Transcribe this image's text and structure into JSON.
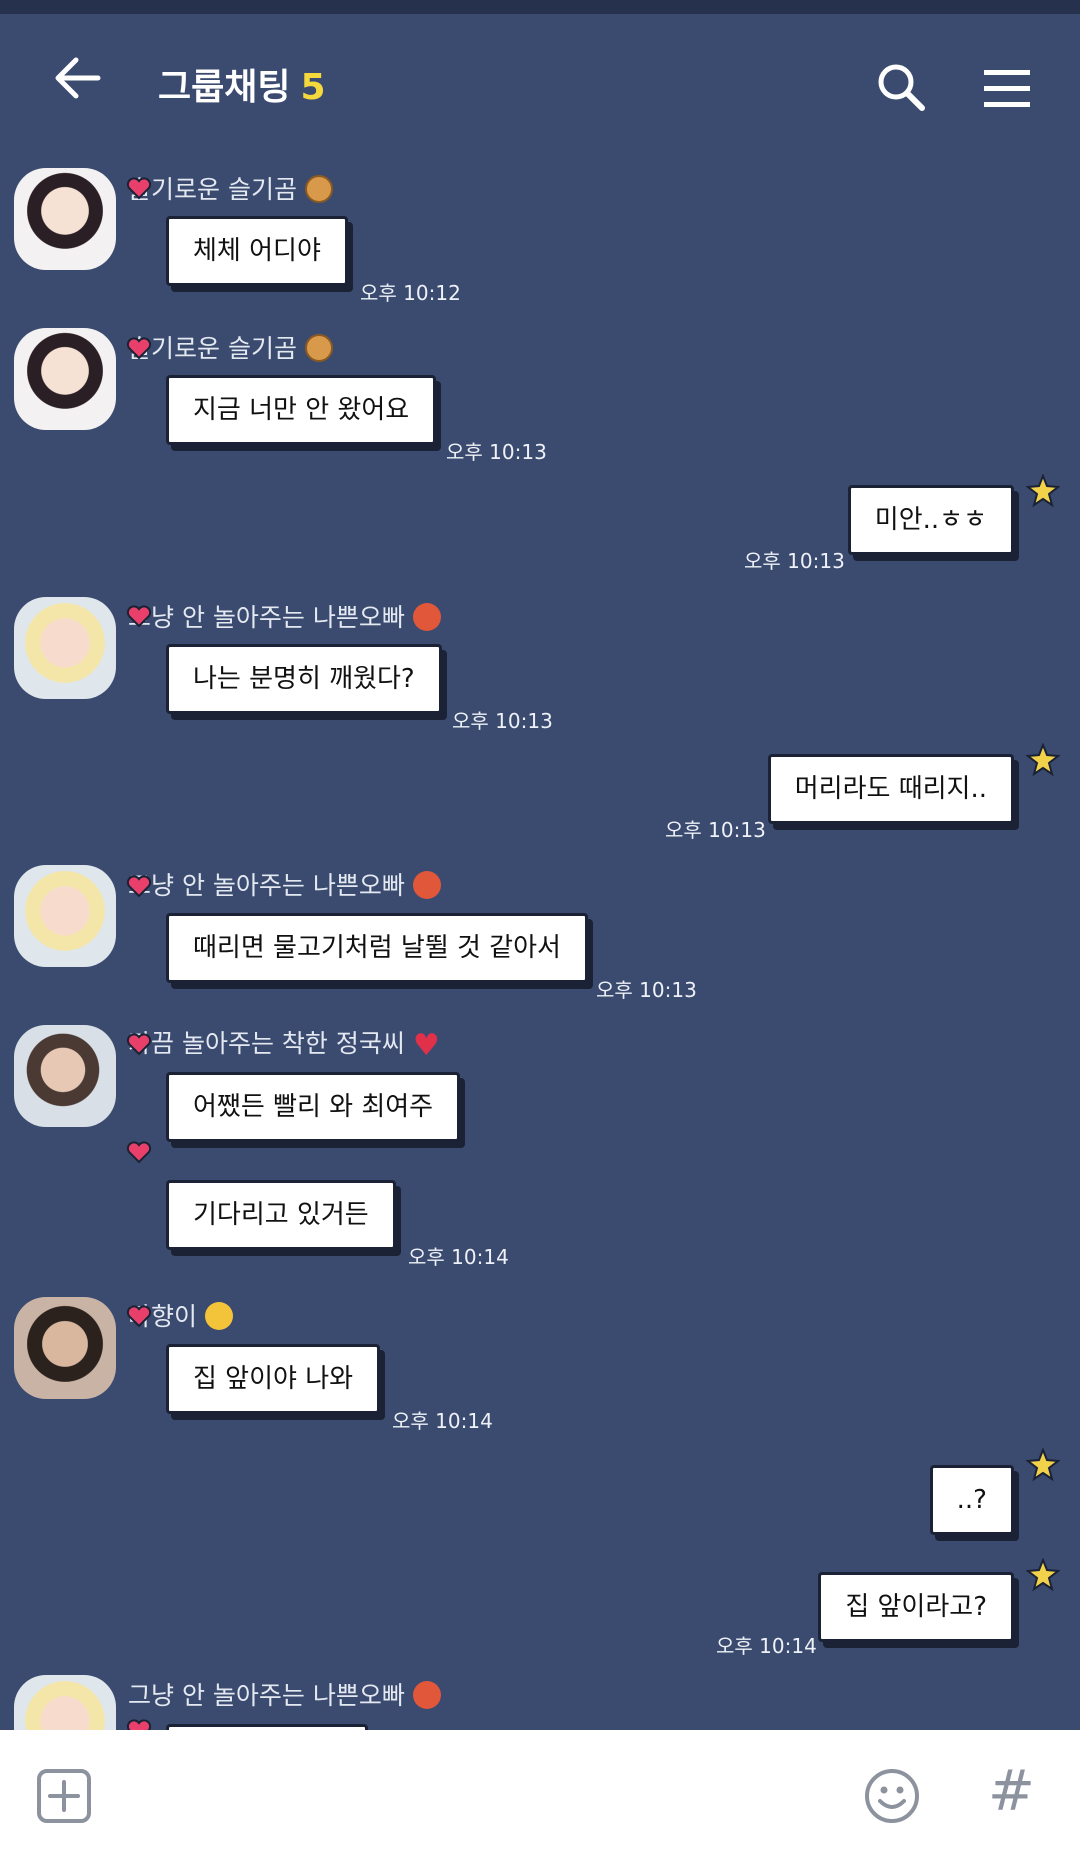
{
  "header": {
    "title": "그룹채팅",
    "member_count": "5"
  },
  "messages": [
    {
      "sender": "슬기로운 슬기곰",
      "text": "체체 어디야",
      "time": "오후 10:12"
    },
    {
      "sender": "슬기로운 슬기곰",
      "text": "지금 너만 안 왔어요",
      "time": "오후 10:13"
    },
    {
      "text": "미안..ㅎㅎ",
      "time": "오후 10:13"
    },
    {
      "sender": "그냥 안 놀아주는 나쁜오빠",
      "text": "나는 분명히 깨웠다?",
      "time": "오후 10:13"
    },
    {
      "text": "머리라도 때리지..",
      "time": "오후 10:13"
    },
    {
      "sender": "그냥 안 놀아주는 나쁜오빠",
      "text": "때리면 물고기처럼 날뛸 것 같아서",
      "time": "오후 10:13"
    },
    {
      "sender": "가끔 놀아주는 착한 정국씨",
      "text": "어쨌든 빨리 와 최여주"
    },
    {
      "text": "기다리고 있거든",
      "time": "오후 10:14"
    },
    {
      "sender": "타향이",
      "text": "집 앞이야 나와",
      "time": "오후 10:14"
    },
    {
      "text": "..?"
    },
    {
      "text": "집 앞이라고?",
      "time": "오후 10:14"
    },
    {
      "sender": "그냥 안 놀아주는 나쁜오빠"
    }
  ]
}
